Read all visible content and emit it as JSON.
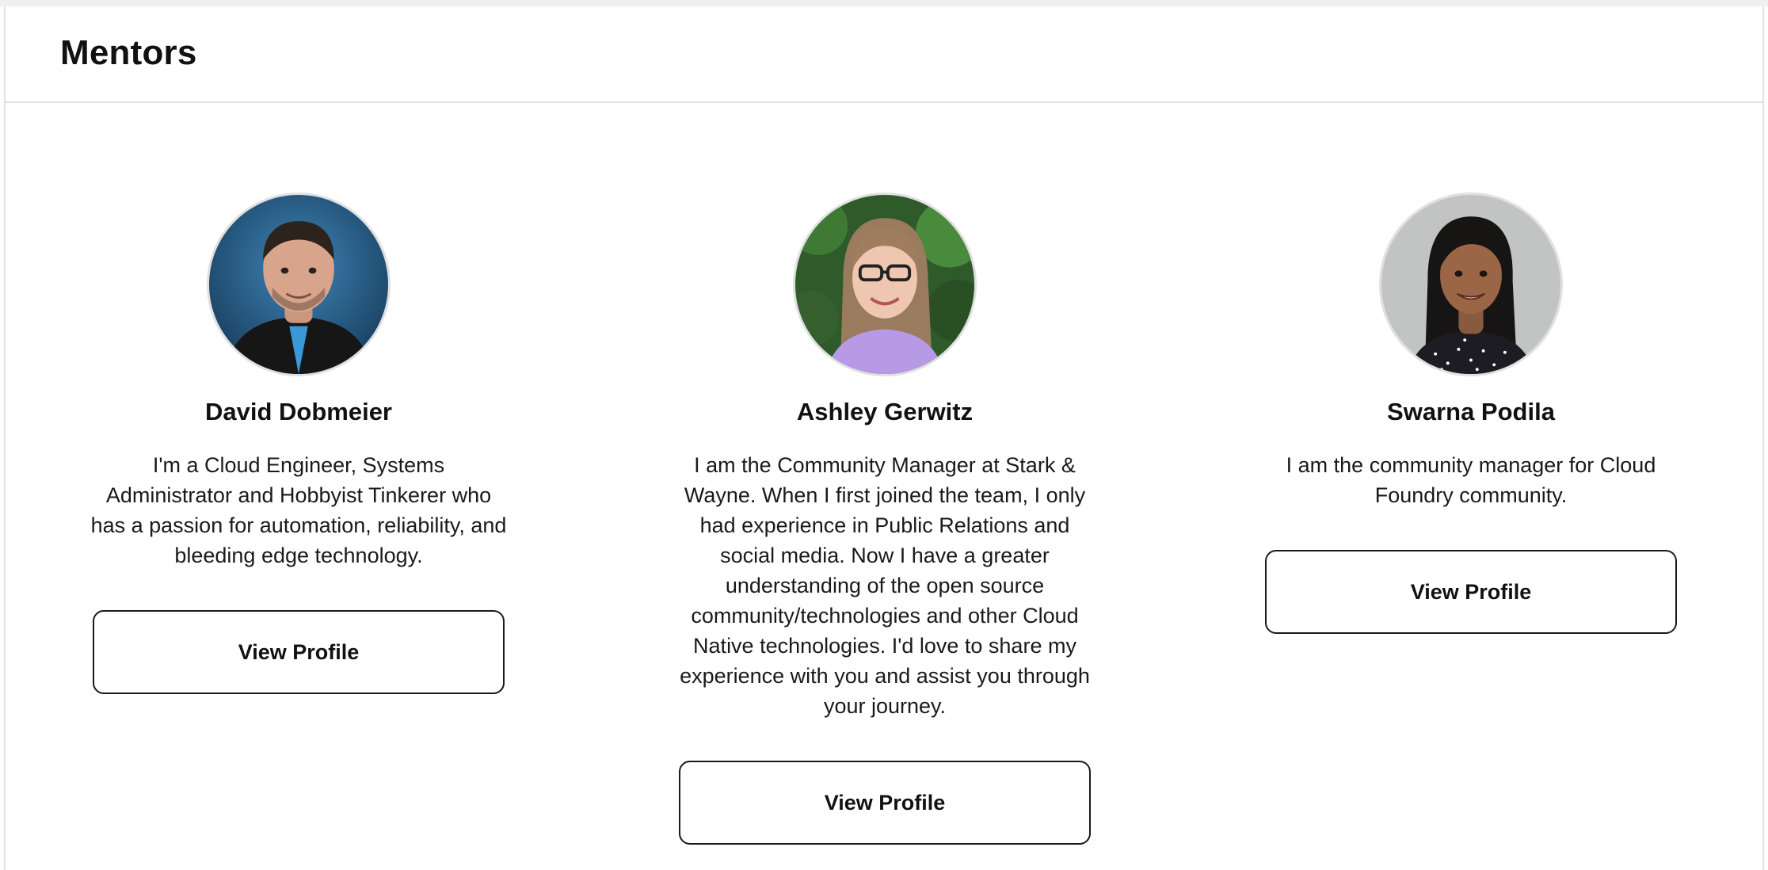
{
  "panel": {
    "title": "Mentors"
  },
  "mentors": [
    {
      "name": "David Dobmeier",
      "bio": "I'm a Cloud Engineer, Systems Administrator and Hobbyist Tinkerer who has a passion for automation, reliability, and bleeding edge technology.",
      "button_label": "View Profile",
      "avatar_icon": "person-photo-icon"
    },
    {
      "name": "Ashley Gerwitz",
      "bio": "I am the Community Manager at Stark & Wayne. When I first joined the team, I only had experience in Public Relations and social media. Now I have a greater understanding of the open source community/technologies and other Cloud Native technologies. I'd love to share my experience with you and assist you through your journey.",
      "button_label": "View Profile",
      "avatar_icon": "person-photo-icon"
    },
    {
      "name": "Swarna Podila",
      "bio": "I am the community manager for Cloud Foundry community.",
      "button_label": "View Profile",
      "avatar_icon": "person-photo-icon"
    }
  ],
  "colors": {
    "border": "#e3e3e3",
    "text": "#111111",
    "button_border": "#1a1a1a"
  }
}
